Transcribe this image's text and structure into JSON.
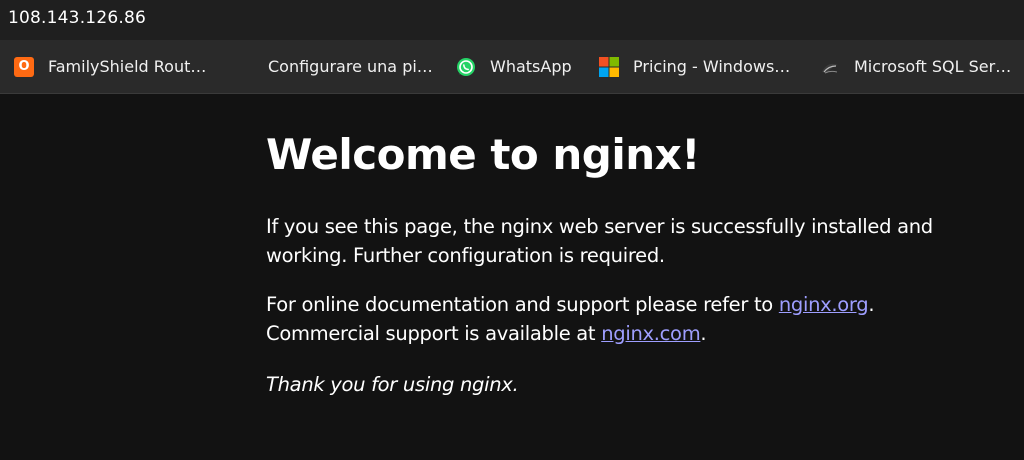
{
  "browser": {
    "url": "108.143.126.86"
  },
  "bookmarks": [
    {
      "label": "FamilyShield Rout…",
      "icon": "familyshield-icon",
      "icon_char": "O"
    },
    {
      "label": "Configurare una pi…",
      "icon": "none"
    },
    {
      "label": "WhatsApp",
      "icon": "whatsapp-icon"
    },
    {
      "label": "Pricing - Windows…",
      "icon": "microsoft-logo-icon"
    },
    {
      "label": "Microsoft SQL Ser…",
      "icon": "sql-server-icon"
    }
  ],
  "page": {
    "title": "Welcome to nginx!",
    "para1": "If you see this page, the nginx web server is successfully installed and working. Further configuration is required.",
    "para2_prefix": "For online documentation and support please refer to ",
    "link_org": "nginx.org",
    "para2_mid": ".",
    "para2_line2": "Commercial support is available at ",
    "link_com": "nginx.com",
    "para2_end": ".",
    "thanks": "Thank you for using nginx."
  },
  "colors": {
    "background": "#121212",
    "link": "#9e9eff",
    "familyshield": "#ff6a13",
    "whatsapp": "#25d366"
  }
}
